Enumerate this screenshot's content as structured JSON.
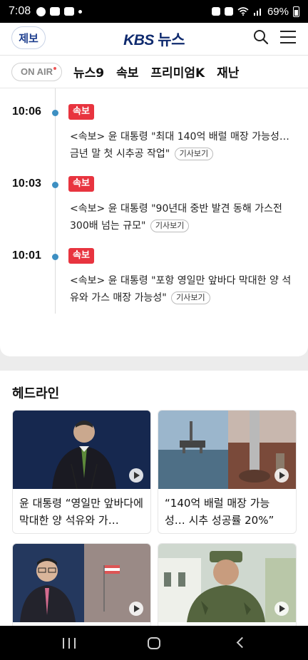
{
  "status_bar": {
    "time": "7:08",
    "battery": "69%"
  },
  "header": {
    "report_label": "제보",
    "logo_kbs": "KBS",
    "logo_news": "뉴스"
  },
  "nav": {
    "onair_label": "ON AIR",
    "tabs": [
      "뉴스9",
      "속보",
      "프리미엄K",
      "재난"
    ]
  },
  "breaking": {
    "items": [
      {
        "time": "10:06",
        "badge": "속보",
        "title": "<속보> 윤 대통령 \"최대 140억 배럴 매장 가능성… 금년 말 첫 시추공 작업\"",
        "button": "기사보기"
      },
      {
        "time": "10:03",
        "badge": "속보",
        "title": "<속보> 윤 대통령 \"90년대 중반 발견 동해 가스전 300배 넘는 규모\"",
        "button": "기사보기"
      },
      {
        "time": "10:01",
        "badge": "속보",
        "title": "<속보> 윤 대통령 \"포항 영일만 앞바다 막대한 양 석유와 가스 매장 가능성\"",
        "button": "기사보기"
      }
    ]
  },
  "headline": {
    "title": "헤드라인",
    "tiles": [
      {
        "caption": "윤 대통령 “영일만 앞바다에 막대한 양 석유와 가…"
      },
      {
        "caption": "“140억 배럴 매장 가능성… 시추 성공률 20%”"
      },
      {
        "caption": ""
      },
      {
        "caption": ""
      }
    ]
  },
  "colors": {
    "brand": "#0f2a6e",
    "badge": "#e8343f",
    "dot": "#3d8fc2"
  }
}
